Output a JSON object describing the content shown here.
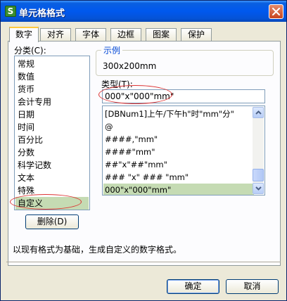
{
  "window": {
    "title": "单元格格式",
    "app_icon": "S",
    "close_icon": "close-icon"
  },
  "tabs": [
    {
      "label": "数字",
      "active": true
    },
    {
      "label": "对齐",
      "active": false
    },
    {
      "label": "字体",
      "active": false
    },
    {
      "label": "边框",
      "active": false
    },
    {
      "label": "图案",
      "active": false
    },
    {
      "label": "保护",
      "active": false
    }
  ],
  "category": {
    "label": "分类(C):",
    "items": [
      "常规",
      "数值",
      "货币",
      "会计专用",
      "日期",
      "时间",
      "百分比",
      "分数",
      "科学记数",
      "文本",
      "特殊",
      "自定义"
    ],
    "selected": "自定义"
  },
  "sample": {
    "label": "示例",
    "value": "300x200mm"
  },
  "type": {
    "label": "类型(T):",
    "value": "000\"x\"000\"mm\"",
    "options": [
      "[DBNum1]上午/下午h\"时\"mm\"分\"",
      "@",
      "####,\"mm\"",
      "####\"mm\"",
      "##\"x\"##\"mm\"",
      "### \"x\" ### \"mm\"",
      "000\"x\"000\"mm\""
    ],
    "selected": "000\"x\"000\"mm\""
  },
  "delete_button": {
    "label": "删除(D)"
  },
  "description": "以现有格式为基础，生成自定义的数字格式。",
  "footer": {
    "ok_label": "确定",
    "cancel_label": "取消"
  },
  "colors": {
    "titlebar": "#0058ee",
    "selection": "#c5dbb3",
    "annotation": "#dd3333",
    "legend_text": "#0046d5"
  }
}
